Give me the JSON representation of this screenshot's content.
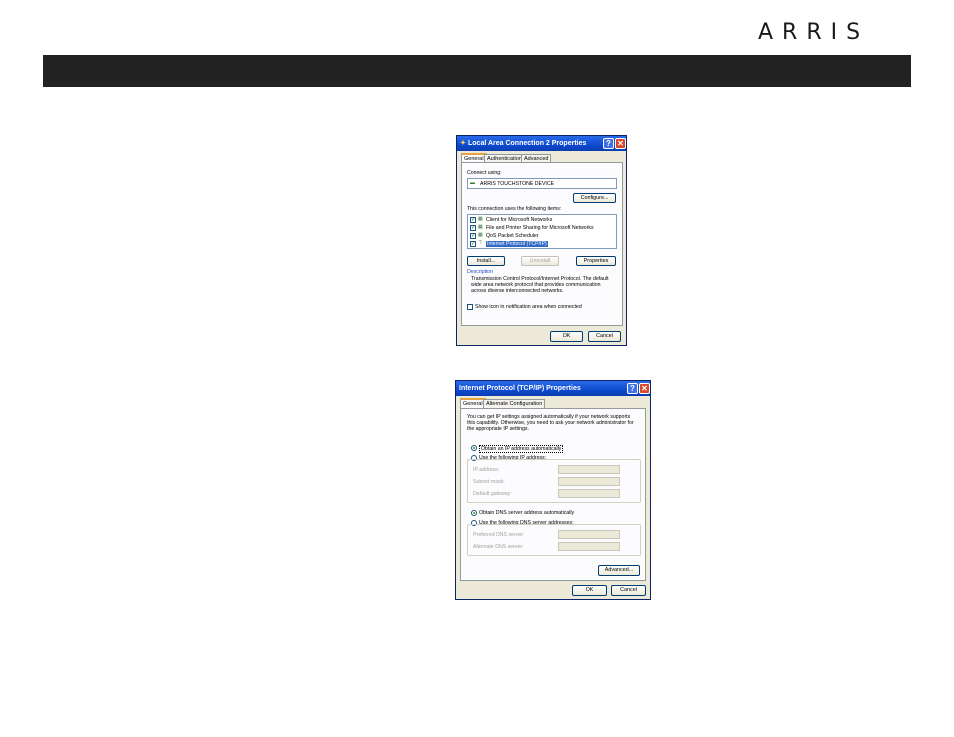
{
  "brand": {
    "logo": "ARRIS"
  },
  "dialog1": {
    "title": "Local Area Connection 2 Properties",
    "tabs": [
      "General",
      "Authentication",
      "Advanced"
    ],
    "connect_using_label": "Connect using:",
    "device": "ARRIS TOUCHSTONE DEVICE",
    "configure": "Configure...",
    "items_label": "This connection uses the following items:",
    "items": [
      "Client for Microsoft Networks",
      "File and Printer Sharing for Microsoft Networks",
      "QoS Packet Scheduler",
      "Internet Protocol (TCP/IP)"
    ],
    "install": "Install...",
    "uninstall": "Uninstall",
    "properties": "Properties",
    "description_label": "Description",
    "description": "Transmission Control Protocol/Internet Protocol. The default wide area network protocol that provides communication across diverse interconnected networks.",
    "show_icon": "Show icon in notification area when connected",
    "ok": "OK",
    "cancel": "Cancel"
  },
  "dialog2": {
    "title": "Internet Protocol (TCP/IP) Properties",
    "tabs": [
      "General",
      "Alternate Configuration"
    ],
    "intro": "You can get IP settings assigned automatically if your network supports this capability. Otherwise, you need to ask your network administrator for the appropriate IP settings.",
    "obtain_ip": "Obtain an IP address automatically",
    "use_ip": "Use the following IP address:",
    "ip_address": "IP address:",
    "subnet_mask": "Subnet mask:",
    "default_gateway": "Default gateway:",
    "obtain_dns": "Obtain DNS server address automatically",
    "use_dns": "Use the following DNS server addresses:",
    "preferred_dns": "Preferred DNS server:",
    "alternate_dns": "Alternate DNS server:",
    "advanced": "Advanced...",
    "ok": "OK",
    "cancel": "Cancel"
  }
}
